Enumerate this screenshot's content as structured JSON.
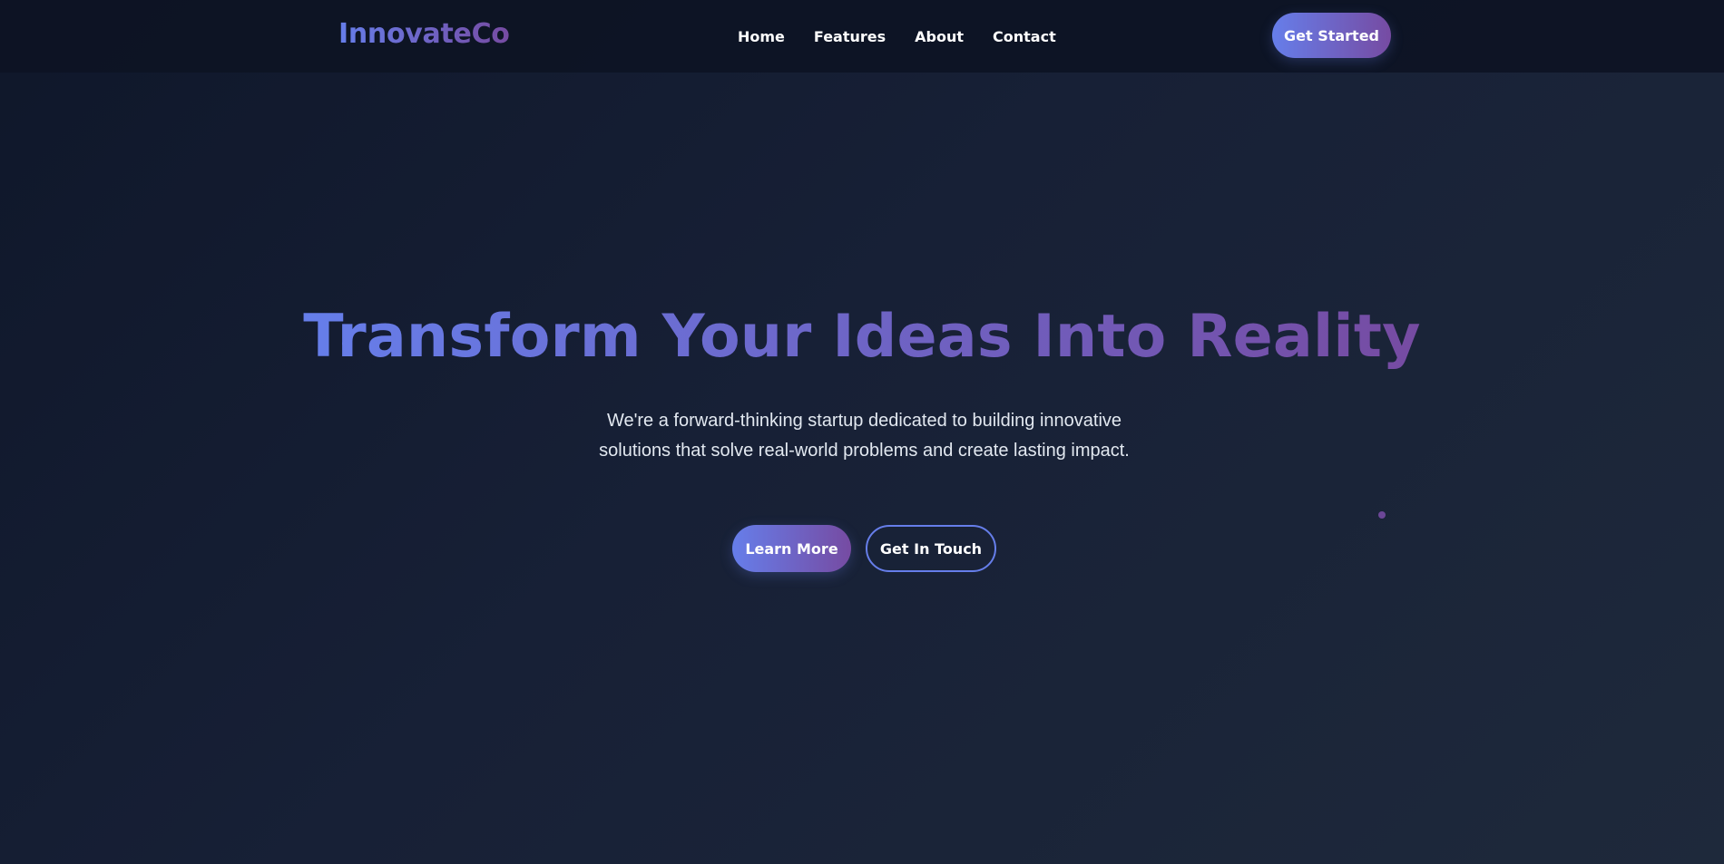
{
  "nav": {
    "logo": "InnovateCo",
    "links": [
      "Home",
      "Features",
      "About",
      "Contact"
    ],
    "cta": "Get Started"
  },
  "hero": {
    "title": "Transform Your Ideas Into Reality",
    "description": "We're a forward-thinking startup dedicated to building innovative solutions that solve real-world problems and create lasting impact.",
    "primary_button": "Learn More",
    "secondary_button": "Get In Touch"
  },
  "colors": {
    "background": "#0f172a",
    "accent_start": "#667eea",
    "accent_end": "#764ba2",
    "text": "#ffffff",
    "muted_text": "#e2e8f0"
  }
}
